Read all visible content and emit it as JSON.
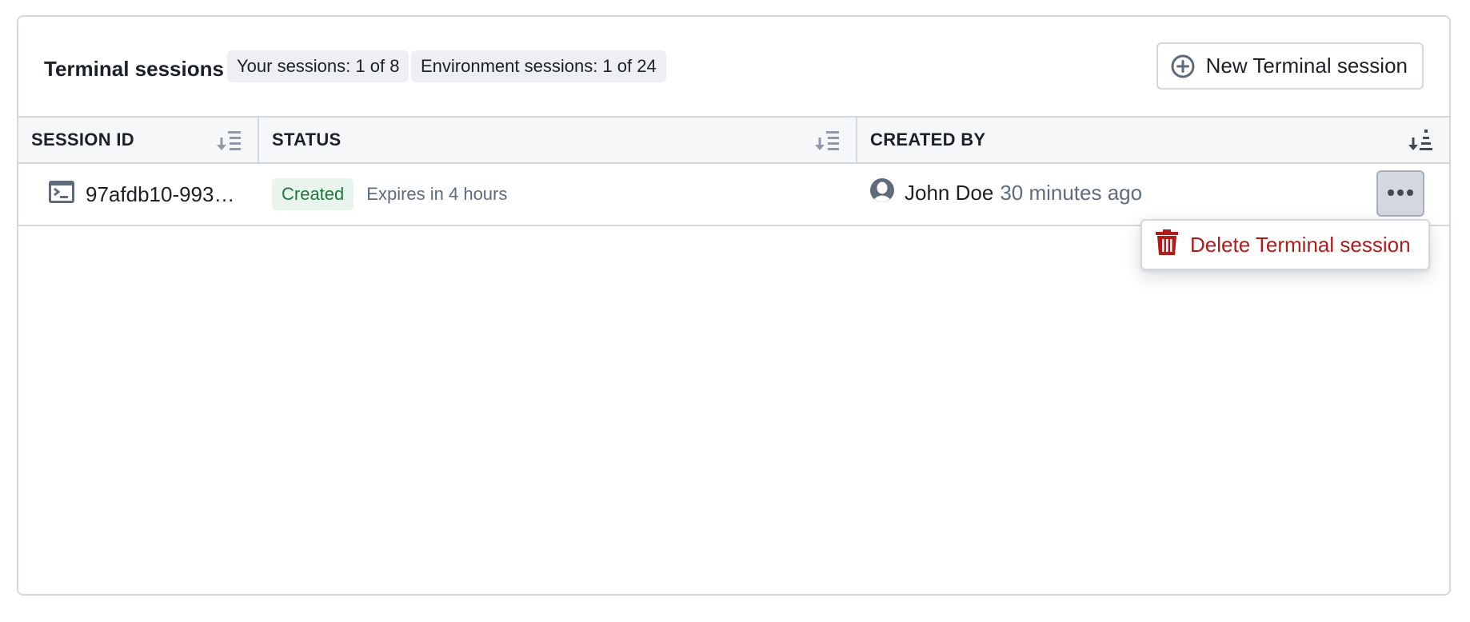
{
  "header": {
    "title": "Terminal sessions",
    "tags": [
      "Your sessions: 1 of 8",
      "Environment sessions: 1 of 24"
    ],
    "new_button_label": "New Terminal session"
  },
  "table": {
    "columns": [
      "SESSION ID",
      "STATUS",
      "CREATED BY"
    ],
    "rows": [
      {
        "session_id": "97afdb10-993…",
        "status": "Created",
        "expires": "Expires in 4 hours",
        "created_by": "John Doe",
        "created_ago": "30 minutes ago"
      }
    ]
  },
  "menu": {
    "items": [
      {
        "label": "Delete Terminal session",
        "icon": "trash-icon"
      }
    ]
  },
  "icons": {
    "new_button": "plus-circle-icon",
    "session": "console-icon",
    "author": "user-icon",
    "more": "more-horizontal-icon",
    "sort": "sort-icon"
  },
  "colors": {
    "status_bg": "#e8f4ec",
    "status_text": "#1d7a3d",
    "danger": "#b31b1b",
    "border": "#d3d8de",
    "muted_text": "#5f6b7c"
  }
}
